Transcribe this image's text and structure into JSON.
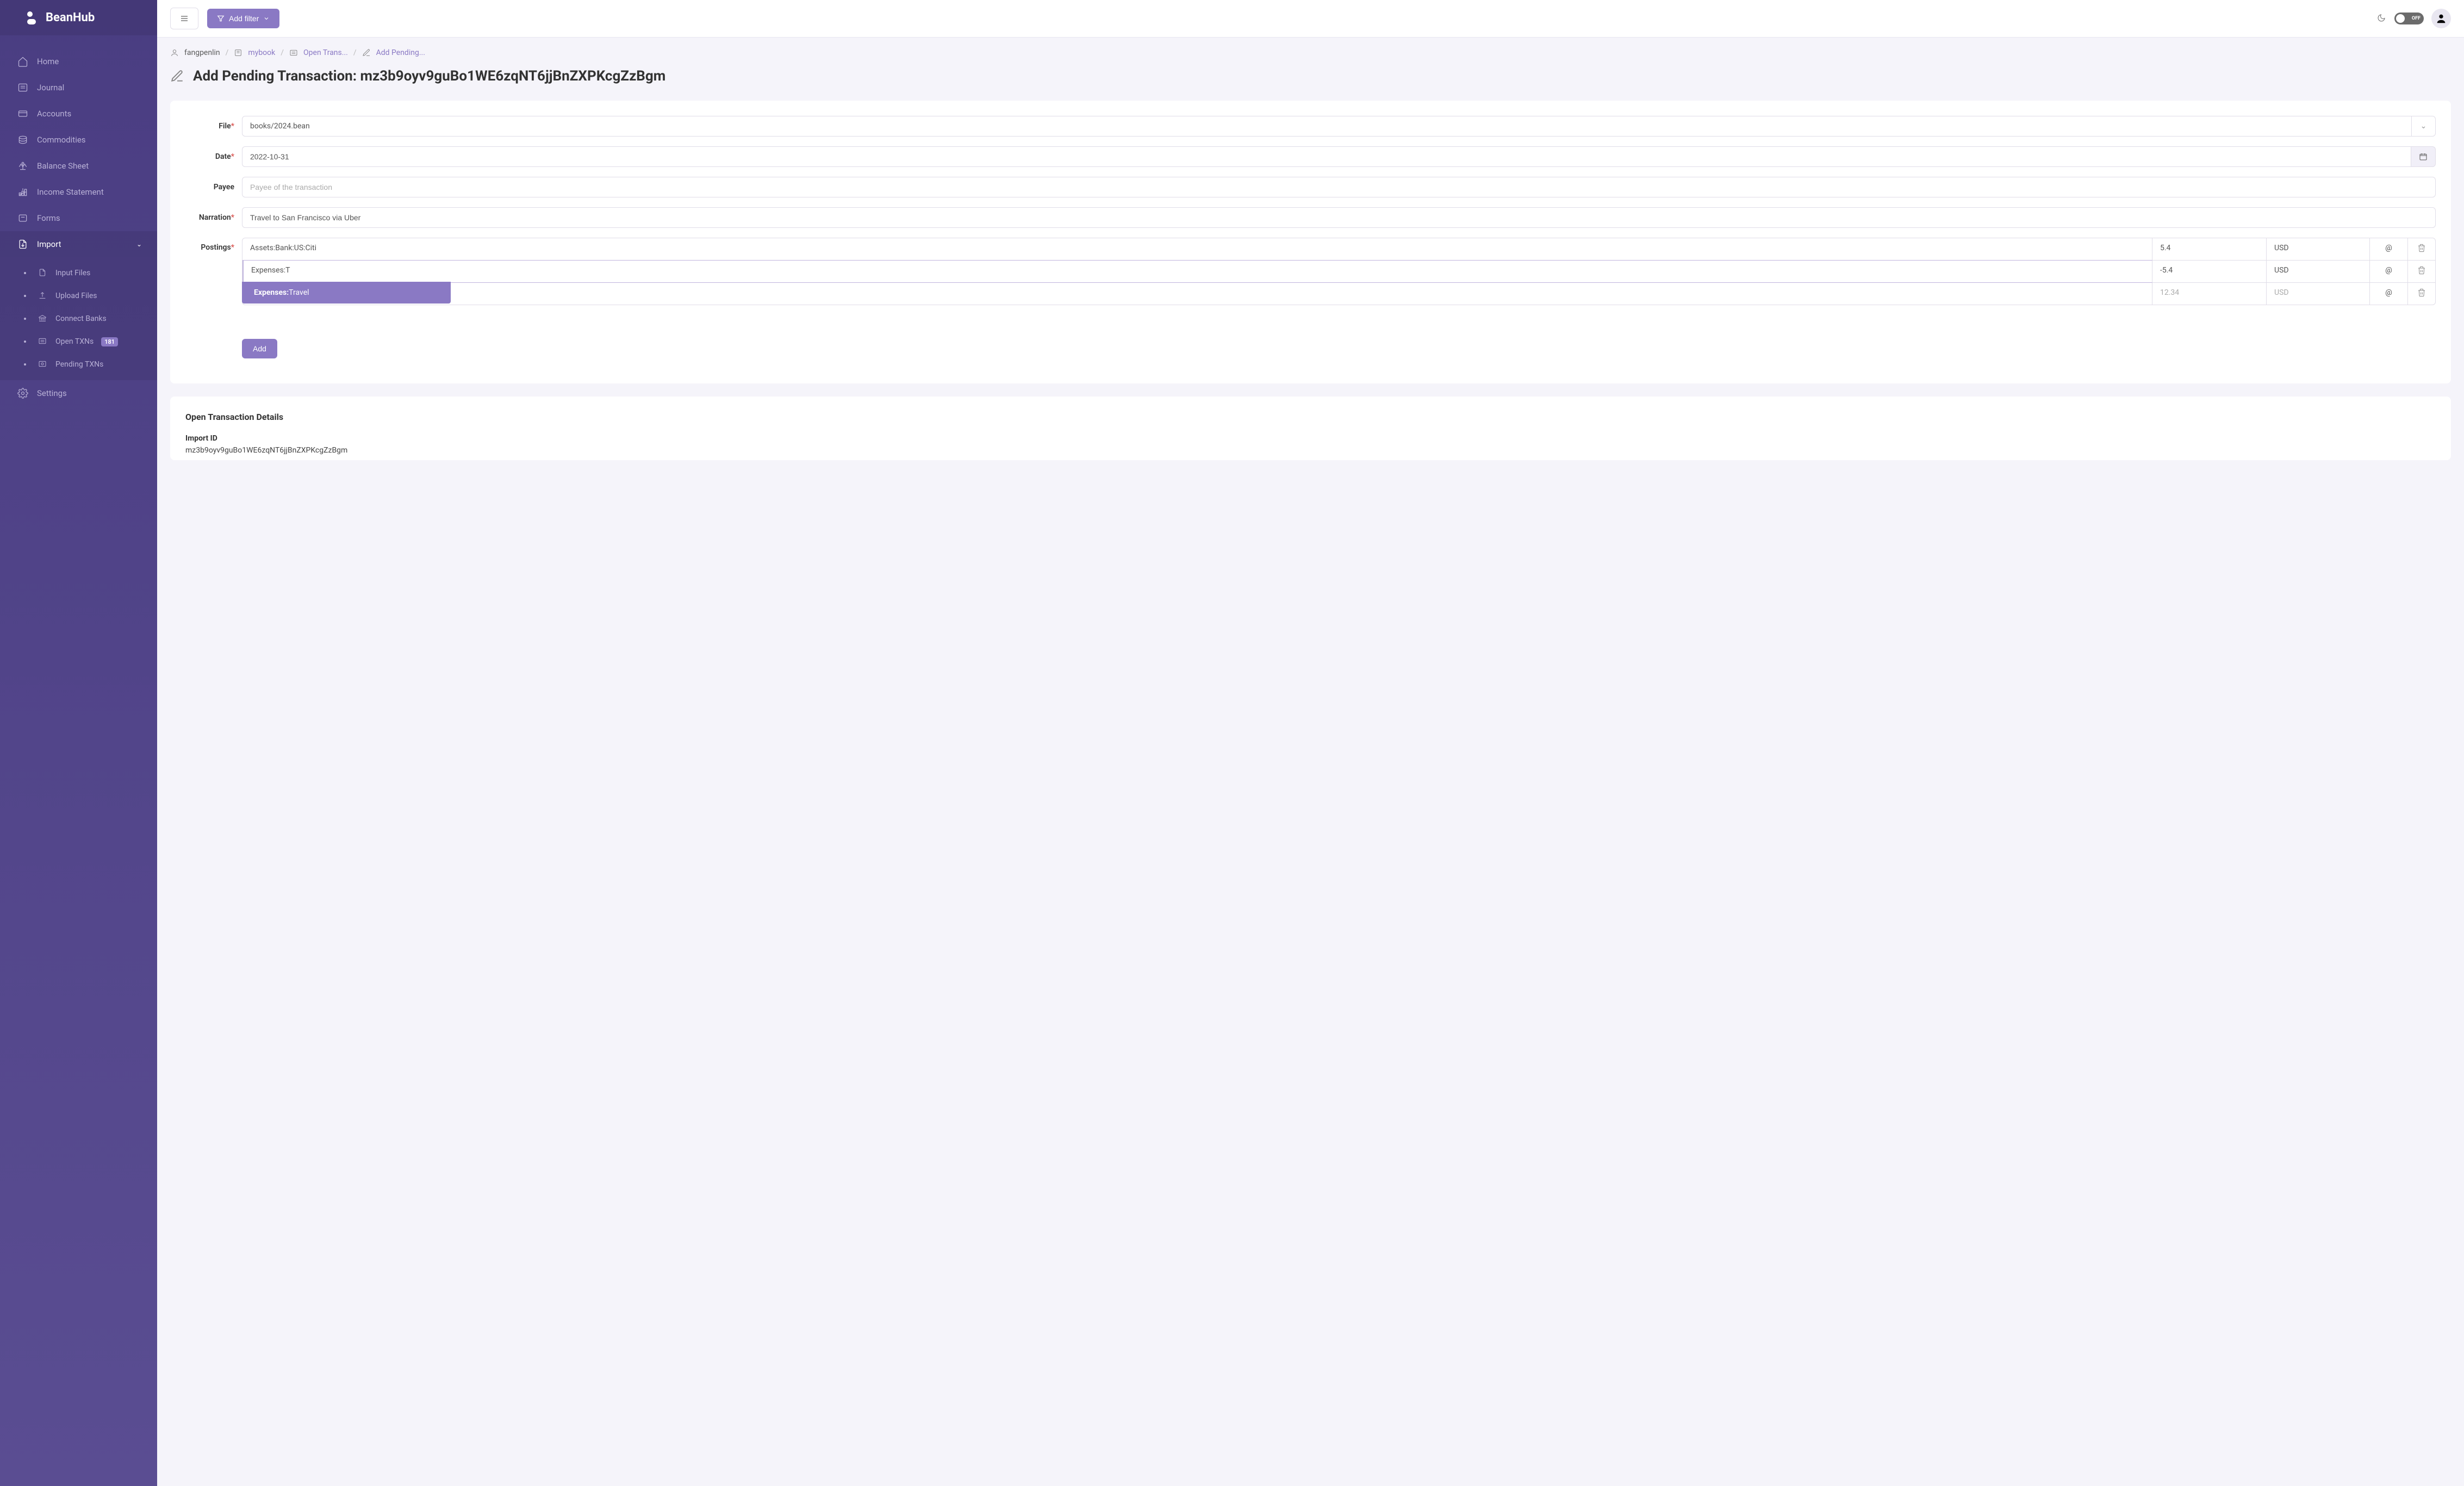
{
  "brand": "BeanHub",
  "sidebar": {
    "items": [
      {
        "label": "Home"
      },
      {
        "label": "Journal"
      },
      {
        "label": "Accounts"
      },
      {
        "label": "Commodities"
      },
      {
        "label": "Balance Sheet"
      },
      {
        "label": "Income Statement"
      },
      {
        "label": "Forms"
      },
      {
        "label": "Import"
      },
      {
        "label": "Settings"
      }
    ],
    "import_sub": [
      {
        "label": "Input Files"
      },
      {
        "label": "Upload Files"
      },
      {
        "label": "Connect Banks"
      },
      {
        "label": "Open TXNs",
        "badge": "181"
      },
      {
        "label": "Pending TXNs"
      }
    ]
  },
  "topbar": {
    "add_filter": "Add filter",
    "toggle_text": "OFF"
  },
  "breadcrumb": {
    "user": "fangpenlin",
    "book": "mybook",
    "open_trans": "Open Trans...",
    "current": "Add Pending..."
  },
  "page_title": "Add Pending Transaction: mz3b9oyv9guBo1WE6zqNT6jjBnZXPKcgZzBgm",
  "form": {
    "file_label": "File",
    "file_value": "books/2024.bean",
    "date_label": "Date",
    "date_value": "2022-10-31",
    "payee_label": "Payee",
    "payee_placeholder": "Payee of the transaction",
    "narration_label": "Narration",
    "narration_value": "Travel to San Francisco via Uber",
    "postings_label": "Postings",
    "postings": [
      {
        "account": "Assets:Bank:US:Citi",
        "amount": "5.4",
        "currency": "USD"
      },
      {
        "account": "Expenses:T",
        "amount": "-5.4",
        "currency": "USD"
      }
    ],
    "posting_placeholder": {
      "amount": "12.34",
      "currency": "USD"
    },
    "autocomplete": {
      "bold": "Expenses:",
      "rest": "Travel"
    },
    "at_symbol": "@",
    "add_label": "Add"
  },
  "details": {
    "section_title": "Open Transaction Details",
    "import_id_label": "Import ID",
    "import_id_value": "mz3b9oyv9guBo1WE6zqNT6jjBnZXPKcgZzBgm"
  }
}
